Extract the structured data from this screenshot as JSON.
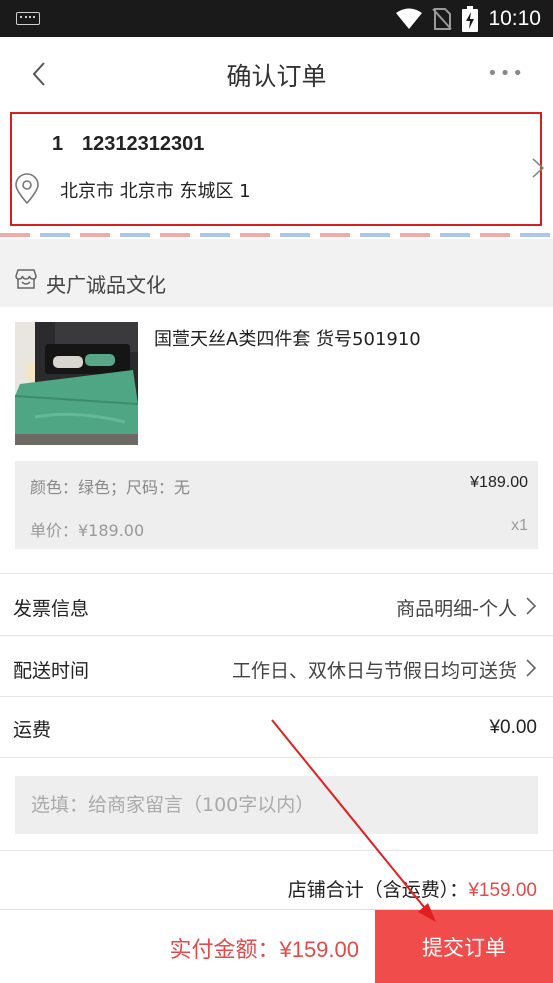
{
  "status_bar": {
    "time": "10:10"
  },
  "nav": {
    "title": "确认订单"
  },
  "address": {
    "name": "1",
    "phone": "12312312301",
    "detail": "北京市 北京市 东城区 1"
  },
  "shop": {
    "name": "央广诚品文化"
  },
  "product": {
    "title": "国萱天丝A类四件套 货号501910",
    "spec": "颜色：绿色；尺码：无",
    "price": "¥189.00",
    "unit_price": "单价：¥189.00",
    "quantity": "x1"
  },
  "rows": {
    "invoice": {
      "label": "发票信息",
      "value": "商品明细-个人"
    },
    "delivery": {
      "label": "配送时间",
      "value": "工作日、双休日与节假日均可送货"
    },
    "shipping": {
      "label": "运费",
      "value": "¥0.00"
    }
  },
  "memo": {
    "placeholder": "选填：给商家留言（100字以内）"
  },
  "subtotal": {
    "label": "店铺合计（含运费）：",
    "amount": "¥159.00"
  },
  "footer": {
    "label": "实付金额：",
    "amount": "¥159.00",
    "submit_label": "提交订单"
  },
  "colors": {
    "accent": "#f04c4c",
    "price_red": "#e24b4b",
    "address_border": "#d81e1e"
  }
}
